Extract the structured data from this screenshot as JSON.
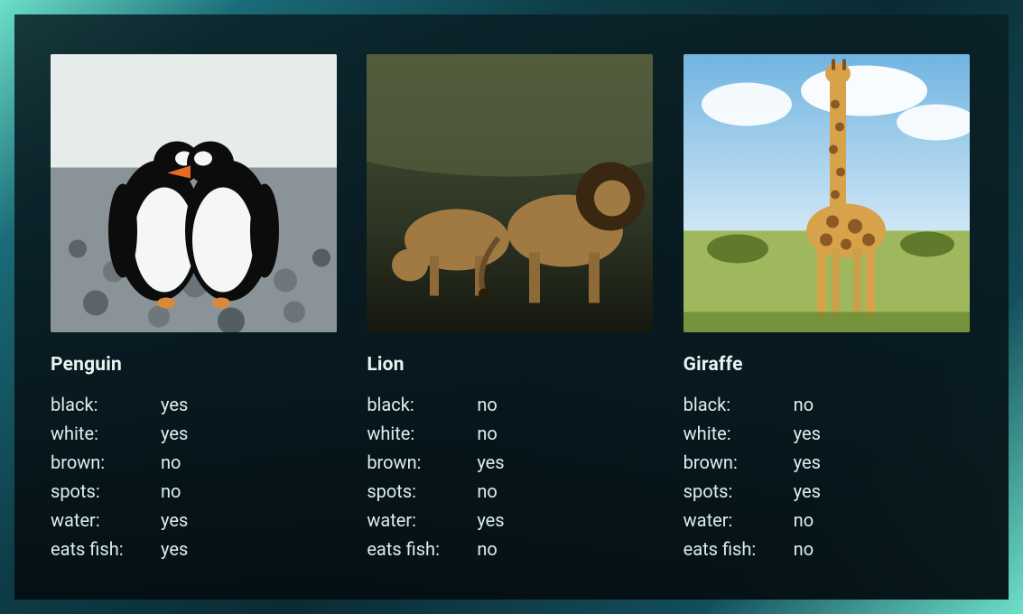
{
  "attributes": [
    "black",
    "white",
    "brown",
    "spots",
    "water",
    "eats fish"
  ],
  "cards": [
    {
      "name": "Penguin",
      "values": {
        "black": "yes",
        "white": "yes",
        "brown": "no",
        "spots": "no",
        "water": "yes",
        "eats fish": "yes"
      }
    },
    {
      "name": "Lion",
      "values": {
        "black": "no",
        "white": "no",
        "brown": "yes",
        "spots": "no",
        "water": "yes",
        "eats fish": "no"
      }
    },
    {
      "name": "Giraffe",
      "values": {
        "black": "no",
        "white": "yes",
        "brown": "yes",
        "spots": "yes",
        "water": "no",
        "eats fish": "no"
      }
    }
  ]
}
